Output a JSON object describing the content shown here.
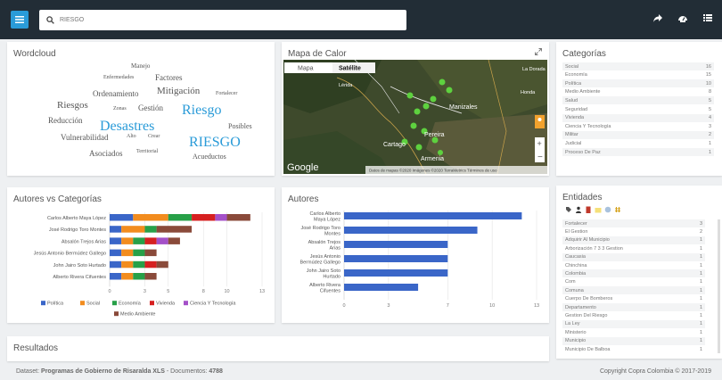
{
  "search": {
    "value": "RIESGO"
  },
  "wordcloud": {
    "title": "Wordcloud",
    "words": [
      {
        "text": "Manejo",
        "size": 7,
        "color": "#555"
      },
      {
        "text": "Enfermedades",
        "size": 6,
        "color": "#555"
      },
      {
        "text": "Factores",
        "size": 9,
        "color": "#555"
      },
      {
        "text": "Ordenamiento",
        "size": 9,
        "color": "#555"
      },
      {
        "text": "Mitigación",
        "size": 11,
        "color": "#555"
      },
      {
        "text": "Fortalecer",
        "size": 6,
        "color": "#555"
      },
      {
        "text": "Riesgos",
        "size": 11,
        "color": "#555"
      },
      {
        "text": "Zonas",
        "size": 6,
        "color": "#555"
      },
      {
        "text": "Gestión",
        "size": 9,
        "color": "#555"
      },
      {
        "text": "Riesgo",
        "size": 16,
        "color": "#2a9bd8"
      },
      {
        "text": "Reducción",
        "size": 9,
        "color": "#555"
      },
      {
        "text": "Desastres",
        "size": 16,
        "color": "#2a9bd8"
      },
      {
        "text": "Posibles",
        "size": 8,
        "color": "#555"
      },
      {
        "text": "Vulnerabilidad",
        "size": 9,
        "color": "#555"
      },
      {
        "text": "Alto",
        "size": 6,
        "color": "#555"
      },
      {
        "text": "Crear",
        "size": 6,
        "color": "#555"
      },
      {
        "text": "RIESGO",
        "size": 16,
        "color": "#2a9bd8"
      },
      {
        "text": "Asociados",
        "size": 9,
        "color": "#555"
      },
      {
        "text": "Territorial",
        "size": 6,
        "color": "#555"
      },
      {
        "text": "Acueductos",
        "size": 8,
        "color": "#555"
      }
    ]
  },
  "map": {
    "title": "Mapa de Calor",
    "tab_map": "Mapa",
    "tab_satellite": "Satélite",
    "logo": "Google",
    "attribution": "Datos de mapas ©2020 Imágenes ©2020 TerraMetrics  Términos de uso",
    "places": [
      "Cartago",
      "Manizales",
      "Pereira",
      "Armenia",
      "La Dorada",
      "Honda",
      "Lérida"
    ]
  },
  "categorias": {
    "title": "Categorías",
    "rows": [
      {
        "label": "Social",
        "value": "16"
      },
      {
        "label": "Economía",
        "value": "15"
      },
      {
        "label": "Política",
        "value": "10"
      },
      {
        "label": "Medio Ambiente",
        "value": "8"
      },
      {
        "label": "Salud",
        "value": "5"
      },
      {
        "label": "Seguridad",
        "value": "5"
      },
      {
        "label": "Vivienda",
        "value": "4"
      },
      {
        "label": "Ciencia Y Tecnología",
        "value": "3"
      },
      {
        "label": "Militar",
        "value": "2"
      },
      {
        "label": "Judicial",
        "value": "1"
      },
      {
        "label": "Proceso De Paz",
        "value": "1"
      }
    ]
  },
  "autores_categorias": {
    "title": "Autores vs Categorías",
    "chart_data": {
      "type": "bar",
      "orientation": "horizontal",
      "stacked": true,
      "categories": [
        "Carlos Alberto Maya López",
        "José Rodrigo Toro Montes",
        "Absalón Trejos Arias",
        "Jesús Antonio Bermúdez Gallego",
        "John Jairo Soto Hurtado",
        "Alberto Rivera Cifuentes"
      ],
      "series": [
        {
          "name": "Política",
          "color": "#3a66c8",
          "values": [
            2,
            1,
            1,
            1,
            1,
            1
          ]
        },
        {
          "name": "Social",
          "color": "#f28c1e",
          "values": [
            3,
            2,
            1,
            1,
            1,
            1
          ]
        },
        {
          "name": "Economía",
          "color": "#27a048",
          "values": [
            2,
            1,
            1,
            1,
            1,
            1
          ]
        },
        {
          "name": "Vivienda",
          "color": "#d62020",
          "values": [
            2,
            0,
            1,
            0,
            1,
            0
          ]
        },
        {
          "name": "Ciencia Y Tecnología",
          "color": "#a450c8",
          "values": [
            1,
            0,
            1,
            0,
            0,
            0
          ]
        },
        {
          "name": "Medio Ambiente",
          "color": "#8a4a3a",
          "values": [
            2,
            3,
            1,
            1,
            1,
            1
          ]
        }
      ],
      "xticks": [
        "0",
        "3",
        "5",
        "8",
        "10",
        "13"
      ],
      "xlim": [
        0,
        13
      ]
    }
  },
  "autores": {
    "title": "Autores",
    "chart_data": {
      "type": "bar",
      "orientation": "horizontal",
      "categories": [
        "Carlos Alberto Maya López",
        "José Rodrigo Toro Montes",
        "Absalón Trejos Arias",
        "Jesús Antonio Bermúdez Gallego",
        "John Jairo Soto Hurtado",
        "Alberto Rivera Cifuentes"
      ],
      "category_lines": [
        [
          "Carlos Alberto",
          "Maya López"
        ],
        [
          "José Rodrigo Toro",
          "Montes"
        ],
        [
          "Absalón Trejos",
          "Arias"
        ],
        [
          "Jesús Antonio",
          "Bermúdez Gallego"
        ],
        [
          "John Jairo Soto",
          "Hurtado"
        ],
        [
          "Alberto Rivera",
          "Cifuentes"
        ]
      ],
      "values": [
        12,
        9,
        7,
        7,
        7,
        5
      ],
      "color": "#3a66c8",
      "xticks": [
        "0",
        "3",
        "7",
        "10",
        "13"
      ],
      "xlim": [
        0,
        13
      ]
    }
  },
  "entidades": {
    "title": "Entidades",
    "rows": [
      {
        "label": "Fortalecer",
        "value": "3"
      },
      {
        "label": "El Gestion",
        "value": "2"
      },
      {
        "label": "Adquirir Al Municipio",
        "value": "1"
      },
      {
        "label": "Arborización 7 3 3 Gestion",
        "value": "1"
      },
      {
        "label": "Caucasia",
        "value": "1"
      },
      {
        "label": "Chinchina",
        "value": "1"
      },
      {
        "label": "Colombia",
        "value": "1"
      },
      {
        "label": "Com",
        "value": "1"
      },
      {
        "label": "Comuna",
        "value": "1"
      },
      {
        "label": "Cuerpo De Bomberos",
        "value": "1"
      },
      {
        "label": "Departamento",
        "value": "1"
      },
      {
        "label": "Gestion Del Riesgo",
        "value": "1"
      },
      {
        "label": "La Ley",
        "value": "1"
      },
      {
        "label": "Ministerio",
        "value": "1"
      },
      {
        "label": "Municipio",
        "value": "1"
      },
      {
        "label": "Municipio De Balboa",
        "value": "1"
      }
    ]
  },
  "resultados": {
    "title": "Resultados"
  },
  "footer": {
    "dataset_prefix": "Dataset:",
    "dataset_name": "Programas de Gobierno de Risaralda XLS",
    "docs_prefix": "- Documentos:",
    "docs_count": "4788",
    "copyright": "Copyright Copra Colombia © 2017-2019"
  }
}
